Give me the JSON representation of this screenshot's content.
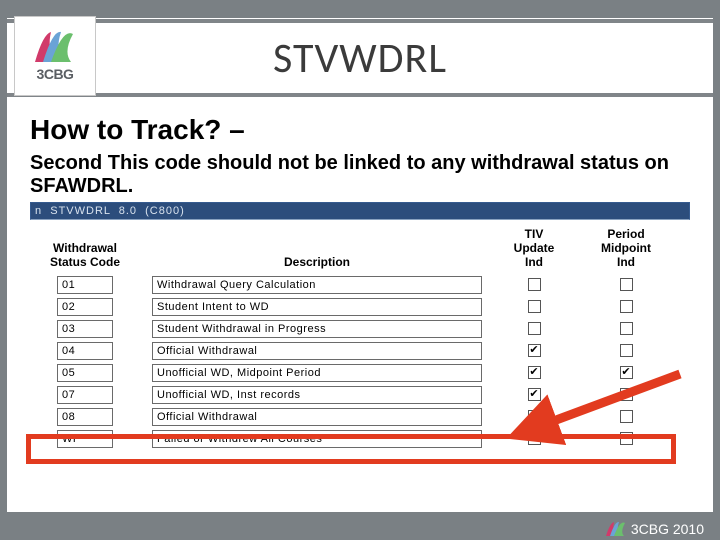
{
  "brand": {
    "logo_text": "3CBG",
    "footer_text": "3CBG 2010"
  },
  "title": "STVWDRL",
  "heading1": "How to Track? –",
  "heading2": "Second  This code should not be linked to any withdrawal status on SFAWDRL.",
  "app_strip": "n  STVWDRL  8.0  (C800)",
  "columns": {
    "code": "Withdrawal\nStatus Code",
    "desc": "Description",
    "tiv": "TIV\nUpdate\nInd",
    "period": "Period\nMidpoint\nInd"
  },
  "rows": [
    {
      "code": "01",
      "desc": "Withdrawal Query Calculation",
      "tiv": false,
      "period": false
    },
    {
      "code": "02",
      "desc": "Student Intent to WD",
      "tiv": false,
      "period": false
    },
    {
      "code": "03",
      "desc": "Student Withdrawal in Progress",
      "tiv": false,
      "period": false
    },
    {
      "code": "04",
      "desc": "Official Withdrawal",
      "tiv": true,
      "period": false
    },
    {
      "code": "05",
      "desc": "Unofficial WD, Midpoint Period",
      "tiv": true,
      "period": true
    },
    {
      "code": "07",
      "desc": "Unofficial WD, Inst records",
      "tiv": true,
      "period": false
    },
    {
      "code": "08",
      "desc": "Official Withdrawal",
      "tiv": true,
      "period": false
    },
    {
      "code": "WF",
      "desc": "Failed or Withdrew All Courses",
      "tiv": false,
      "period": false
    }
  ]
}
